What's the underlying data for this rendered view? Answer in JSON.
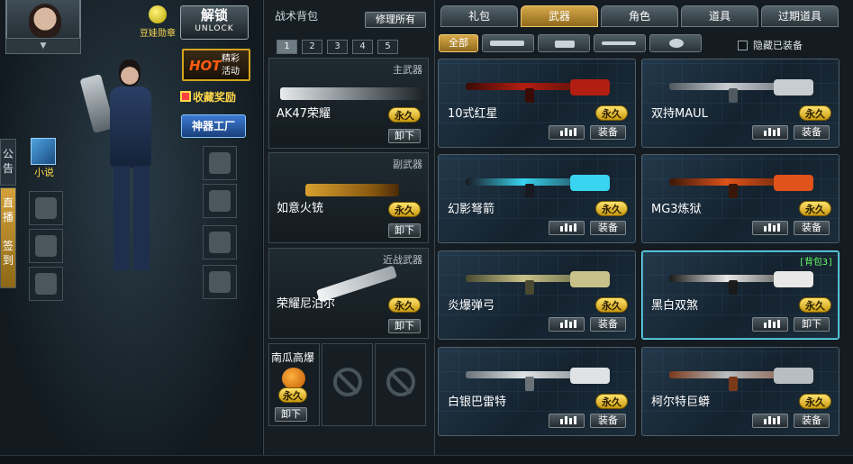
{
  "left": {
    "medal_label": "豆娃勋章",
    "unlock": {
      "zh": "解锁",
      "en": "UNLOCK"
    },
    "hot": {
      "hot": "HOT",
      "label": "精彩活动"
    },
    "collect_label": "收藏奖励",
    "factory_label": "神器工厂",
    "side_tabs": [
      "公告",
      "直播",
      "签到"
    ],
    "novel_label": "小说"
  },
  "mid": {
    "title": "战术背包",
    "repair_label": "修理所有",
    "pack_tabs": [
      "1",
      "2",
      "3",
      "4",
      "5"
    ],
    "slots": [
      {
        "category": "主武器",
        "name": "AK47荣耀",
        "status": "永久",
        "action": "卸下"
      },
      {
        "category": "副武器",
        "name": "如意火铳",
        "status": "永久",
        "action": "卸下"
      },
      {
        "category": "近战武器",
        "name": "荣耀尼泊尔",
        "status": "永久",
        "action": "卸下"
      }
    ],
    "throwable": {
      "name": "南瓜高爆",
      "status": "永久",
      "action": "卸下"
    }
  },
  "right": {
    "tabs": [
      "礼包",
      "武器",
      "角色",
      "道具",
      "过期道具"
    ],
    "active_tab": "武器",
    "sub_tabs": [
      "全部",
      "rifle-icon",
      "pistol-icon",
      "knife-icon",
      "grenade-icon"
    ],
    "hide_equipped_label": "隐藏已装备",
    "items": [
      {
        "name": "10式红星",
        "status": "永久",
        "action": "装备",
        "colors": [
          "#b21e12",
          "#3a0a06"
        ]
      },
      {
        "name": "双持MAUL",
        "status": "永久",
        "action": "装备",
        "colors": [
          "#c7cdd1",
          "#505860"
        ]
      },
      {
        "name": "幻影弩箭",
        "status": "永久",
        "action": "装备",
        "colors": [
          "#38d4f0",
          "#1a1a22"
        ]
      },
      {
        "name": "MG3炼狱",
        "status": "永久",
        "action": "装备",
        "colors": [
          "#e0531a",
          "#3a1608"
        ]
      },
      {
        "name": "炎爆弹弓",
        "status": "永久",
        "action": "装备",
        "colors": [
          "#c8c28a",
          "#4a4a30"
        ]
      },
      {
        "name": "黑白双煞",
        "status": "永久",
        "action": "卸下",
        "tag": "[背包3]",
        "colors": [
          "#e8e8e8",
          "#1a1a1a"
        ]
      },
      {
        "name": "白银巴雷特",
        "status": "永久",
        "action": "装备",
        "colors": [
          "#dfe3e6",
          "#6a7278"
        ]
      },
      {
        "name": "柯尔特巨蟒",
        "status": "永久",
        "action": "装备",
        "colors": [
          "#b8bec2",
          "#7a3a1a"
        ]
      }
    ]
  }
}
